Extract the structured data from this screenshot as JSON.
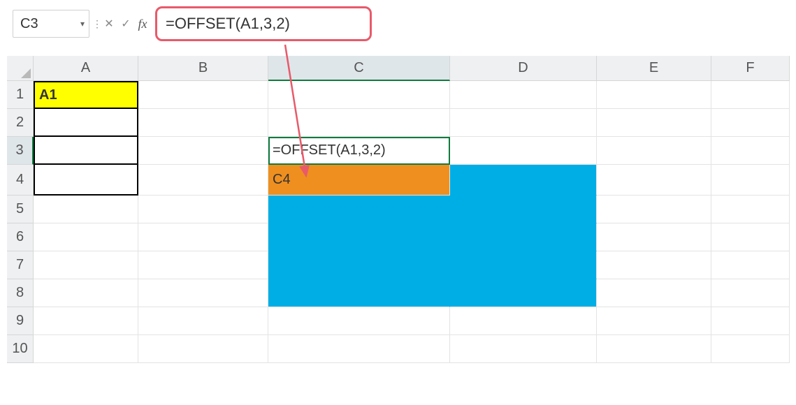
{
  "namebox": {
    "value": "C3"
  },
  "formula_bar": {
    "cancel_glyph": "✕",
    "enter_glyph": "✓",
    "fx_label": "fx",
    "formula": "=OFFSET(A1,3,2)"
  },
  "columns": [
    "A",
    "B",
    "C",
    "D",
    "E",
    "F"
  ],
  "rows": [
    "1",
    "2",
    "3",
    "4",
    "5",
    "6",
    "7",
    "8",
    "9",
    "10"
  ],
  "cells": {
    "A1": "A1",
    "C3_display": "=OFFSET(A1,3,2)",
    "C4": "C4"
  },
  "colors": {
    "highlight_border": "#e85a6a",
    "selection_border": "#0f7b3f",
    "yellow": "#ffff00",
    "orange": "#ef8f1f",
    "blue": "#00aee6"
  },
  "active_cell": "C3"
}
